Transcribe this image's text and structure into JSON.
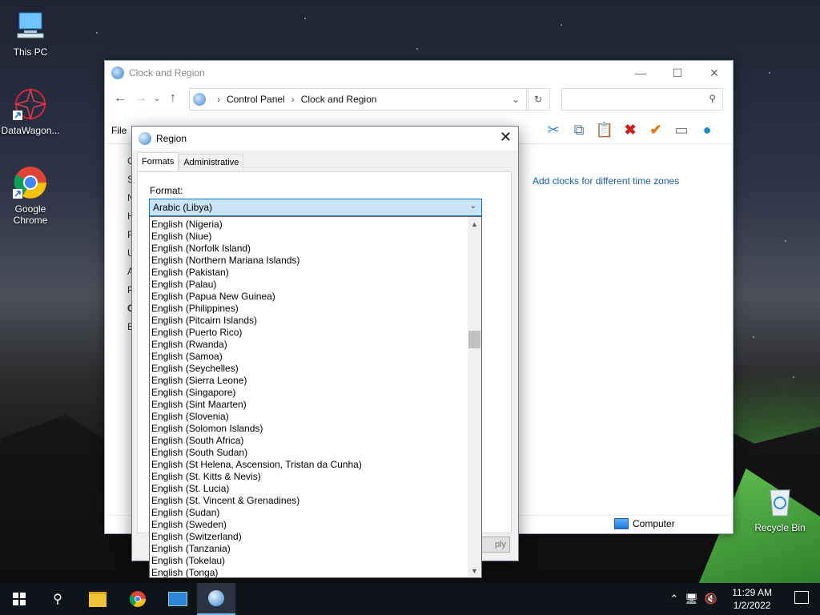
{
  "desktop": {
    "icons": [
      {
        "label": "This PC",
        "icon": "this-pc-icon"
      },
      {
        "label": "DataWagon...",
        "icon": "datawagon-icon"
      },
      {
        "label": "Google Chrome",
        "icon": "chrome-icon"
      },
      {
        "label": "Recycle Bin",
        "icon": "recycle-bin-icon"
      }
    ]
  },
  "explorer": {
    "title": "Clock and Region",
    "breadcrumb": [
      "Control Panel",
      "Clock and Region"
    ],
    "menu_file": "File",
    "link_time_zones": "Add clocks for different time zones",
    "status_computer": "Computer",
    "left_fragments": [
      "C",
      "S",
      "N",
      "H",
      "P",
      "U",
      "A",
      "P",
      "C",
      "E"
    ]
  },
  "region_dialog": {
    "title": "Region",
    "tabs": [
      "Formats",
      "Administrative"
    ],
    "active_tab": "Formats",
    "format_label": "Format:",
    "selected_format": "Arabic (Libya)",
    "apply_label": "ply",
    "format_options": [
      "English (Nigeria)",
      "English (Niue)",
      "English (Norfolk Island)",
      "English (Northern Mariana Islands)",
      "English (Pakistan)",
      "English (Palau)",
      "English (Papua New Guinea)",
      "English (Philippines)",
      "English (Pitcairn Islands)",
      "English (Puerto Rico)",
      "English (Rwanda)",
      "English (Samoa)",
      "English (Seychelles)",
      "English (Sierra Leone)",
      "English (Singapore)",
      "English (Sint Maarten)",
      "English (Slovenia)",
      "English (Solomon Islands)",
      "English (South Africa)",
      "English (South Sudan)",
      "English (St Helena, Ascension, Tristan da Cunha)",
      "English (St. Kitts & Nevis)",
      "English (St. Lucia)",
      "English (St. Vincent & Grenadines)",
      "English (Sudan)",
      "English (Sweden)",
      "English (Switzerland)",
      "English (Tanzania)",
      "English (Tokelau)",
      "English (Tonga)"
    ]
  },
  "taskbar": {
    "time": "11:29 AM",
    "date": "1/2/2022"
  }
}
